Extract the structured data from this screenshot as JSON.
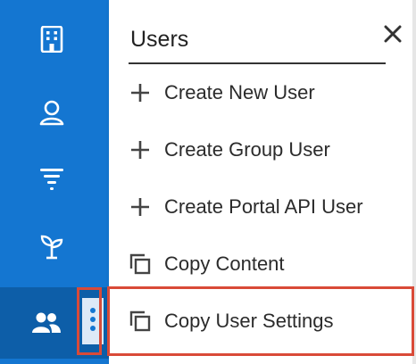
{
  "panel": {
    "title": "Users",
    "close_icon": "close-icon",
    "items": [
      {
        "label": "Create New User",
        "icon": "plus-icon"
      },
      {
        "label": "Create Group User",
        "icon": "plus-icon"
      },
      {
        "label": "Create Portal API User",
        "icon": "plus-icon"
      },
      {
        "label": "Copy Content",
        "icon": "copy-icon"
      },
      {
        "label": "Copy User Settings",
        "icon": "copy-icon"
      }
    ]
  },
  "sidebar": {
    "items": [
      {
        "icon": "building-icon"
      },
      {
        "icon": "user-icon"
      },
      {
        "icon": "filter-icon"
      },
      {
        "icon": "plant-icon"
      },
      {
        "icon": "users-icon",
        "active": true
      }
    ],
    "kebab_icon": "kebab-menu-icon"
  },
  "colors": {
    "sidebar_bg": "#1476d1",
    "sidebar_active_bg": "#0d5ea8",
    "highlight": "#d94a38",
    "text": "#2b2b2b"
  }
}
